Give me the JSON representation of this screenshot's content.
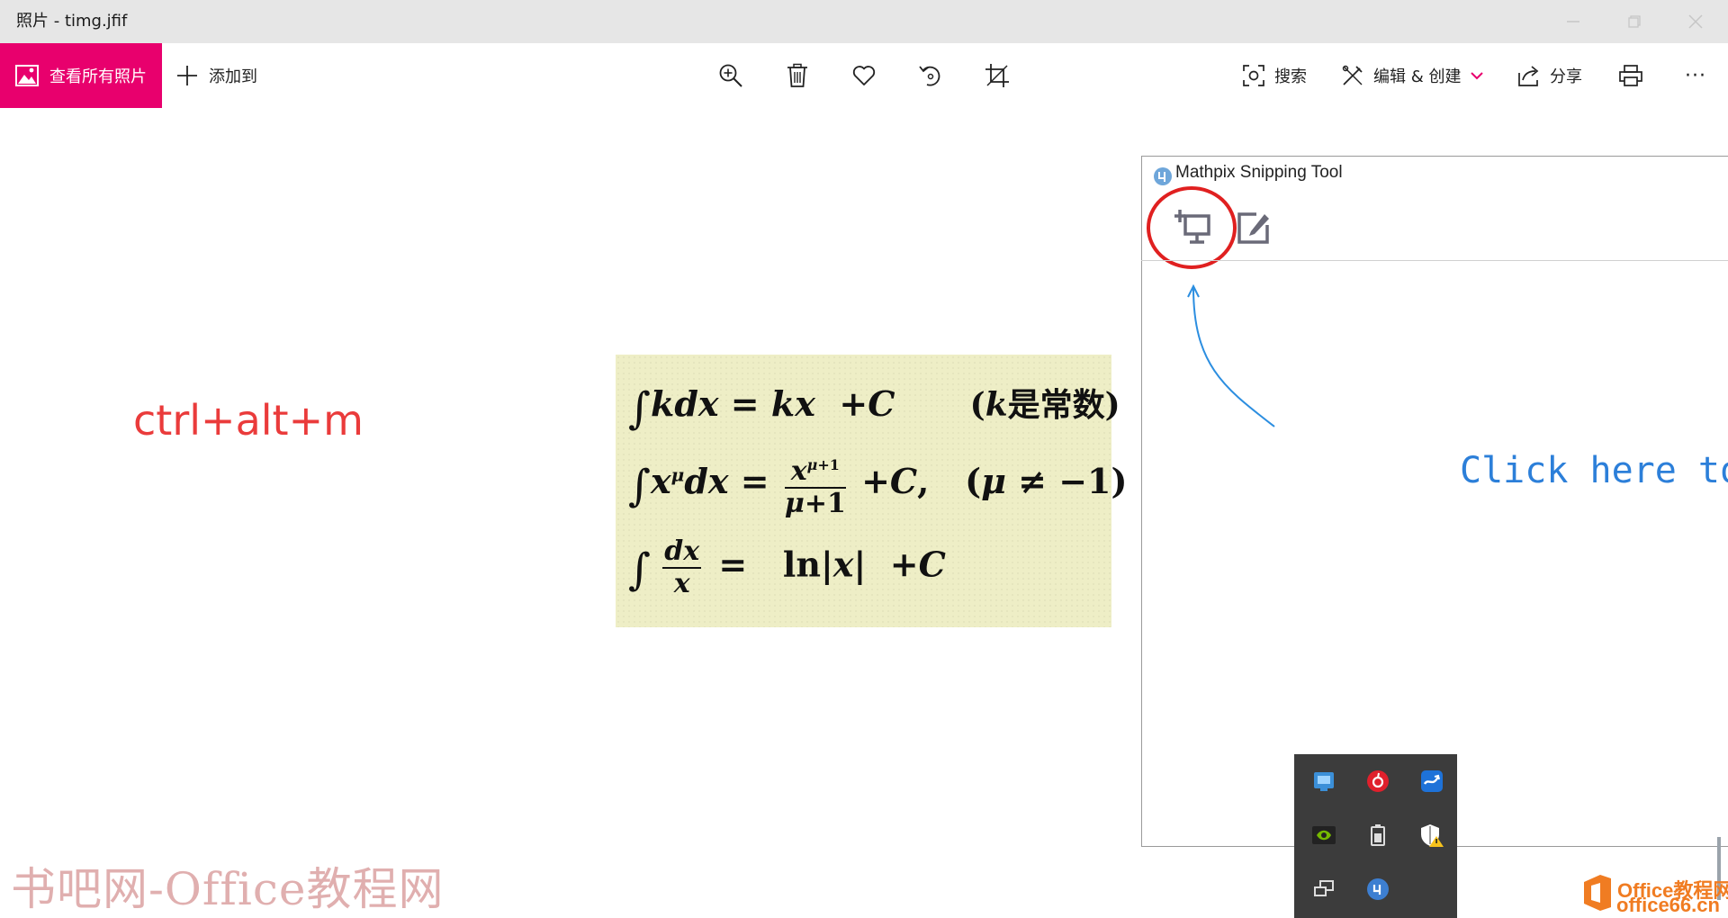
{
  "window": {
    "title": "照片 - timg.jfif",
    "controls": [
      "minimize",
      "maximize",
      "close"
    ]
  },
  "toolbar": {
    "view_all_label": "查看所有照片",
    "add_to_label": "添加到",
    "center_icons": [
      "zoom-in-icon",
      "delete-icon",
      "favorite-icon",
      "rotate-icon",
      "crop-icon"
    ],
    "search_label": "搜索",
    "edit_create_label": "编辑 & 创建",
    "share_label": "分享",
    "more_label": "···",
    "accent": "#e8006d"
  },
  "photo": {
    "shortcut_text": "ctrl+alt+m",
    "shortcut_color": "#ea3b3b",
    "formulas": [
      "∫kdx = kx +C      (k是常数)",
      "∫x^μ dx = x^(μ+1)/(μ+1) +C,  (μ≠−1)",
      "∫dx/x = ln|x| +C"
    ]
  },
  "mathpix": {
    "title": "Mathpix Snipping Tool",
    "hint": "Click here to t",
    "hint_color": "#2c7fd9",
    "annotation_color": "#e02020"
  },
  "tray": {
    "icons": [
      "network-status-icon",
      "netease-music-icon",
      "upload-client-icon",
      "nvidia-icon",
      "battery-icon",
      "security-warning-icon",
      "display-switch-icon",
      "mathpix-tray-icon"
    ]
  },
  "watermarks": {
    "left": "书吧网-Office教程网",
    "right_line1": "Office教程网",
    "right_line2": "office66.cn"
  }
}
